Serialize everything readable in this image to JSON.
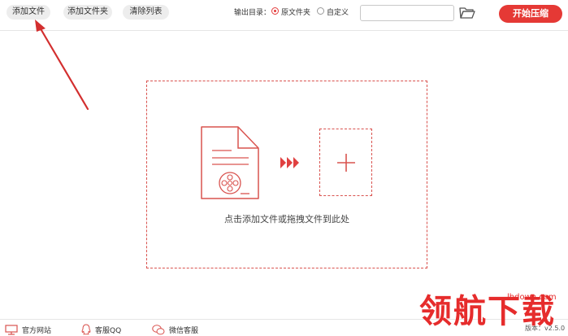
{
  "toolbar": {
    "add_file": "添加文件",
    "add_folder": "添加文件夹",
    "clear_list": "清除列表",
    "output_dir_label": "输出目录：",
    "radio_original": "原文件夹",
    "radio_custom": "自定义",
    "selected_output": "原文件夹",
    "path_value": "",
    "start": "开始压缩"
  },
  "drop_zone": {
    "hint": "点击添加文件或拖拽文件到此处"
  },
  "footer": {
    "website": "官方网站",
    "qq": "客服QQ",
    "wechat": "微信客服",
    "version": "版本：v2.5.0"
  },
  "watermark": {
    "text": "领航下载",
    "domain": "lhdown.com"
  },
  "colors": {
    "accent": "#e53935",
    "dashed": "#d9534f",
    "button_bg": "#ededed"
  },
  "icons": [
    "folder-icon",
    "video-file-icon",
    "triple-arrow-icon",
    "plus-icon",
    "monitor-icon",
    "qq-icon",
    "wechat-icon"
  ]
}
